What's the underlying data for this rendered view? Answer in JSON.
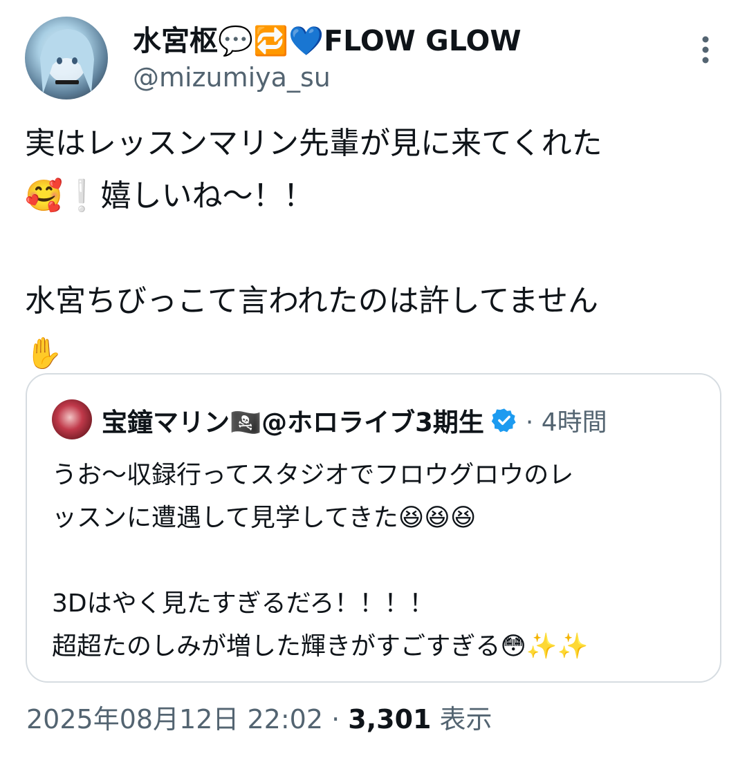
{
  "author": {
    "display_name": "水宮枢💬🔁💙FLOW GLOW",
    "handle": "@mizumiya_su"
  },
  "tweet": {
    "text": "実はレッスンマリン先輩が見に来てくれた\n🥰❕嬉しいね〜！！\n\n水宮ちびっこて言われたのは許してません\n✋"
  },
  "quote": {
    "author_name": "宝鐘マリン🏴‍☠️@ホロライブ3期生",
    "time": "· 4時間",
    "text": "うお〜収録行ってスタジオでフロウグロウのレ\nッスンに遭遇して見学してきた😆😆😆\n\n3Dはやく見たすぎるだろ！！！！\n超超たのしみが増した輝きがすごすぎる😳✨✨"
  },
  "meta": {
    "timestamp": "2025年08月12日 22:02",
    "separator": " · ",
    "views_count": "3,301",
    "views_label": " 表示"
  },
  "icons": {
    "more": "more-vertical-icon",
    "verified": "verified-badge-icon"
  },
  "colors": {
    "text_primary": "#0f1419",
    "text_secondary": "#536471",
    "verified_blue": "#1d9bf0",
    "border": "#d6dce1"
  }
}
